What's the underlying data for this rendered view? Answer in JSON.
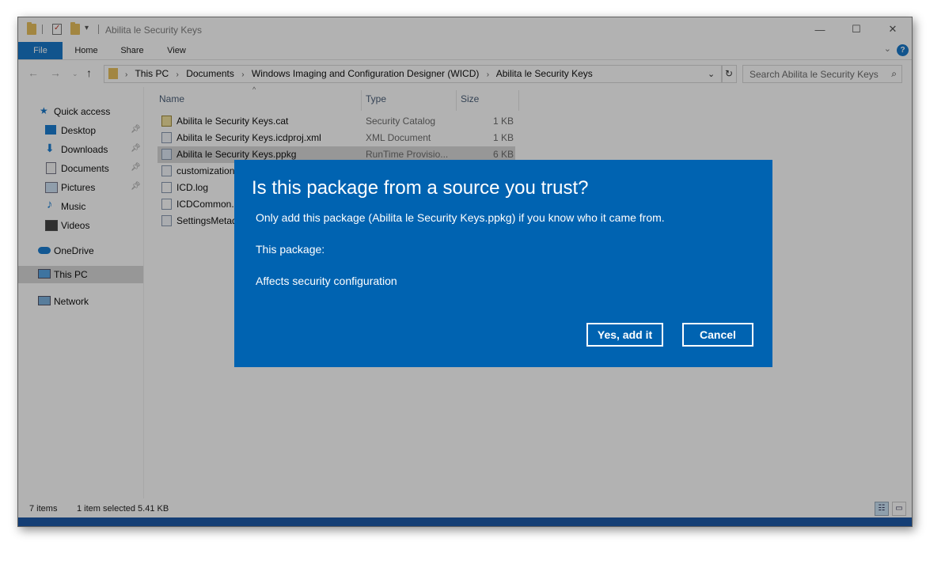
{
  "window": {
    "title": "Abilita le Security Keys",
    "controls": {
      "minimize": "—",
      "maximize": "☐",
      "close": "✕"
    }
  },
  "ribbon": {
    "tabs": [
      "File",
      "Home",
      "Share",
      "View"
    ],
    "help": "?"
  },
  "address": {
    "crumbs": [
      "This PC",
      "Documents",
      "Windows Imaging and Configuration Designer (WICD)",
      "Abilita le Security Keys"
    ],
    "search_placeholder": "Search Abilita le Security Keys"
  },
  "nav": {
    "quick_access": "Quick access",
    "items": [
      {
        "label": "Desktop",
        "icon": "desktop-icon",
        "pinned": true
      },
      {
        "label": "Downloads",
        "icon": "downloads-icon",
        "pinned": true
      },
      {
        "label": "Documents",
        "icon": "documents-icon",
        "pinned": true
      },
      {
        "label": "Pictures",
        "icon": "pictures-icon",
        "pinned": true
      },
      {
        "label": "Music",
        "icon": "music-icon",
        "pinned": false
      },
      {
        "label": "Videos",
        "icon": "videos-icon",
        "pinned": false
      }
    ],
    "onedrive": "OneDrive",
    "this_pc": "This PC",
    "network": "Network"
  },
  "columns": {
    "name": "Name",
    "type": "Type",
    "size": "Size"
  },
  "files": [
    {
      "name": "Abilita le Security Keys.cat",
      "type": "Security Catalog",
      "size": "1 KB"
    },
    {
      "name": "Abilita le Security Keys.icdproj.xml",
      "type": "XML Document",
      "size": "1 KB"
    },
    {
      "name": "Abilita le Security Keys.ppkg",
      "type": "RunTime Provisio...",
      "size": "6 KB"
    },
    {
      "name": "customization",
      "type": "",
      "size": ""
    },
    {
      "name": "ICD.log",
      "type": "",
      "size": ""
    },
    {
      "name": "ICDCommon.l",
      "type": "",
      "size": ""
    },
    {
      "name": "SettingsMetad",
      "type": "",
      "size": ""
    }
  ],
  "status": {
    "items": "7 items",
    "selected": "1 item selected  5.41 KB"
  },
  "dialog": {
    "title": "Is this package from a source you trust?",
    "line1": "Only add this package (Abilita le Security Keys.ppkg) if you know who it came from.",
    "line2": "This package:",
    "line3": "Affects security configuration",
    "yes": "Yes, add it",
    "cancel": "Cancel"
  },
  "colors": {
    "accent": "#0063b1",
    "file_tab": "#1979ca"
  }
}
